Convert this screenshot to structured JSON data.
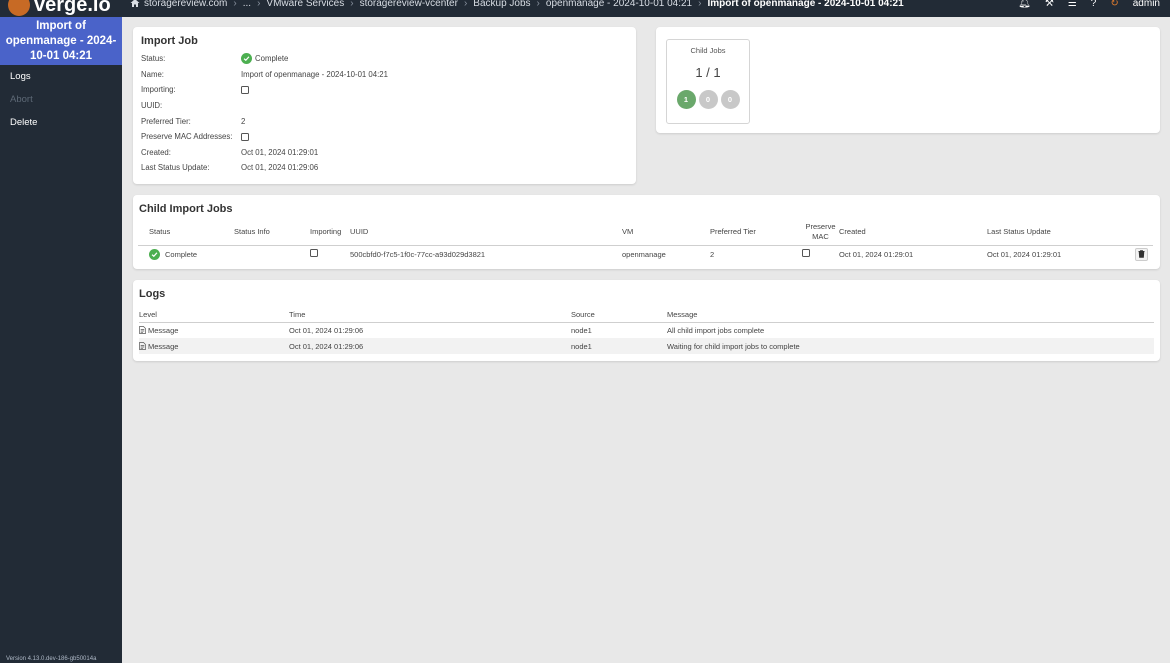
{
  "app": {
    "logo_text": "verge.io",
    "version": "Version 4.13.0.dev-186-gb50014a"
  },
  "breadcrumb": [
    {
      "label": "storagereview.com"
    },
    {
      "label": "..."
    },
    {
      "label": "VMware Services"
    },
    {
      "label": "storagereview-vcenter"
    },
    {
      "label": "Backup Jobs"
    },
    {
      "label": "openmanage - 2024-10-01 04:21"
    },
    {
      "label": "Import of openmanage - 2024-10-01 04:21"
    }
  ],
  "topbar": {
    "user": "admin"
  },
  "sidebar": {
    "title": "Import of openmanage - 2024-10-01 04:21",
    "items": [
      {
        "label": "Logs",
        "enabled": true
      },
      {
        "label": "Abort",
        "enabled": false
      },
      {
        "label": "Delete",
        "enabled": true
      }
    ]
  },
  "import_job": {
    "title": "Import Job",
    "fields": {
      "status_label": "Status:",
      "status_value": "Complete",
      "name_label": "Name:",
      "name_value": "Import of openmanage - 2024-10-01 04:21",
      "importing_label": "Importing:",
      "uuid_label": "UUID:",
      "uuid_value": "",
      "tier_label": "Preferred Tier:",
      "tier_value": "2",
      "mac_label": "Preserve MAC Addresses:",
      "created_label": "Created:",
      "created_value": "Oct 01, 2024 01:29:01",
      "last_update_label": "Last Status Update:",
      "last_update_value": "Oct 01, 2024 01:29:06"
    }
  },
  "child_jobs": {
    "title": "Child Jobs",
    "count": "1 / 1",
    "indicators": [
      "1",
      "0",
      "0"
    ]
  },
  "child_import_jobs": {
    "title": "Child Import Jobs",
    "headers": {
      "status": "Status",
      "status_info": "Status Info",
      "importing": "Importing",
      "uuid": "UUID",
      "vm": "VM",
      "tier": "Preferred Tier",
      "preserve_mac": "Preserve MAC",
      "created": "Created",
      "last_update": "Last Status Update"
    },
    "rows": [
      {
        "status": "Complete",
        "status_info": "",
        "uuid": "500cbfd0-f7c5-1f0c-77cc-a93d029d3821",
        "vm": "openmanage",
        "tier": "2",
        "created": "Oct 01, 2024 01:29:01",
        "last_update": "Oct 01, 2024 01:29:01"
      }
    ]
  },
  "logs": {
    "title": "Logs",
    "headers": {
      "level": "Level",
      "time": "Time",
      "source": "Source",
      "message": "Message"
    },
    "rows": [
      {
        "level": "Message",
        "time": "Oct 01, 2024 01:29:06",
        "source": "node1",
        "message": "All child import jobs complete"
      },
      {
        "level": "Message",
        "time": "Oct 01, 2024 01:29:06",
        "source": "node1",
        "message": "Waiting for child import jobs to complete"
      }
    ]
  },
  "colors": {
    "sidebar_bg": "#222b36",
    "sidebar_title_bg": "#4a63c9",
    "success": "#4caf50",
    "accent_orange": "#e07b2e"
  }
}
